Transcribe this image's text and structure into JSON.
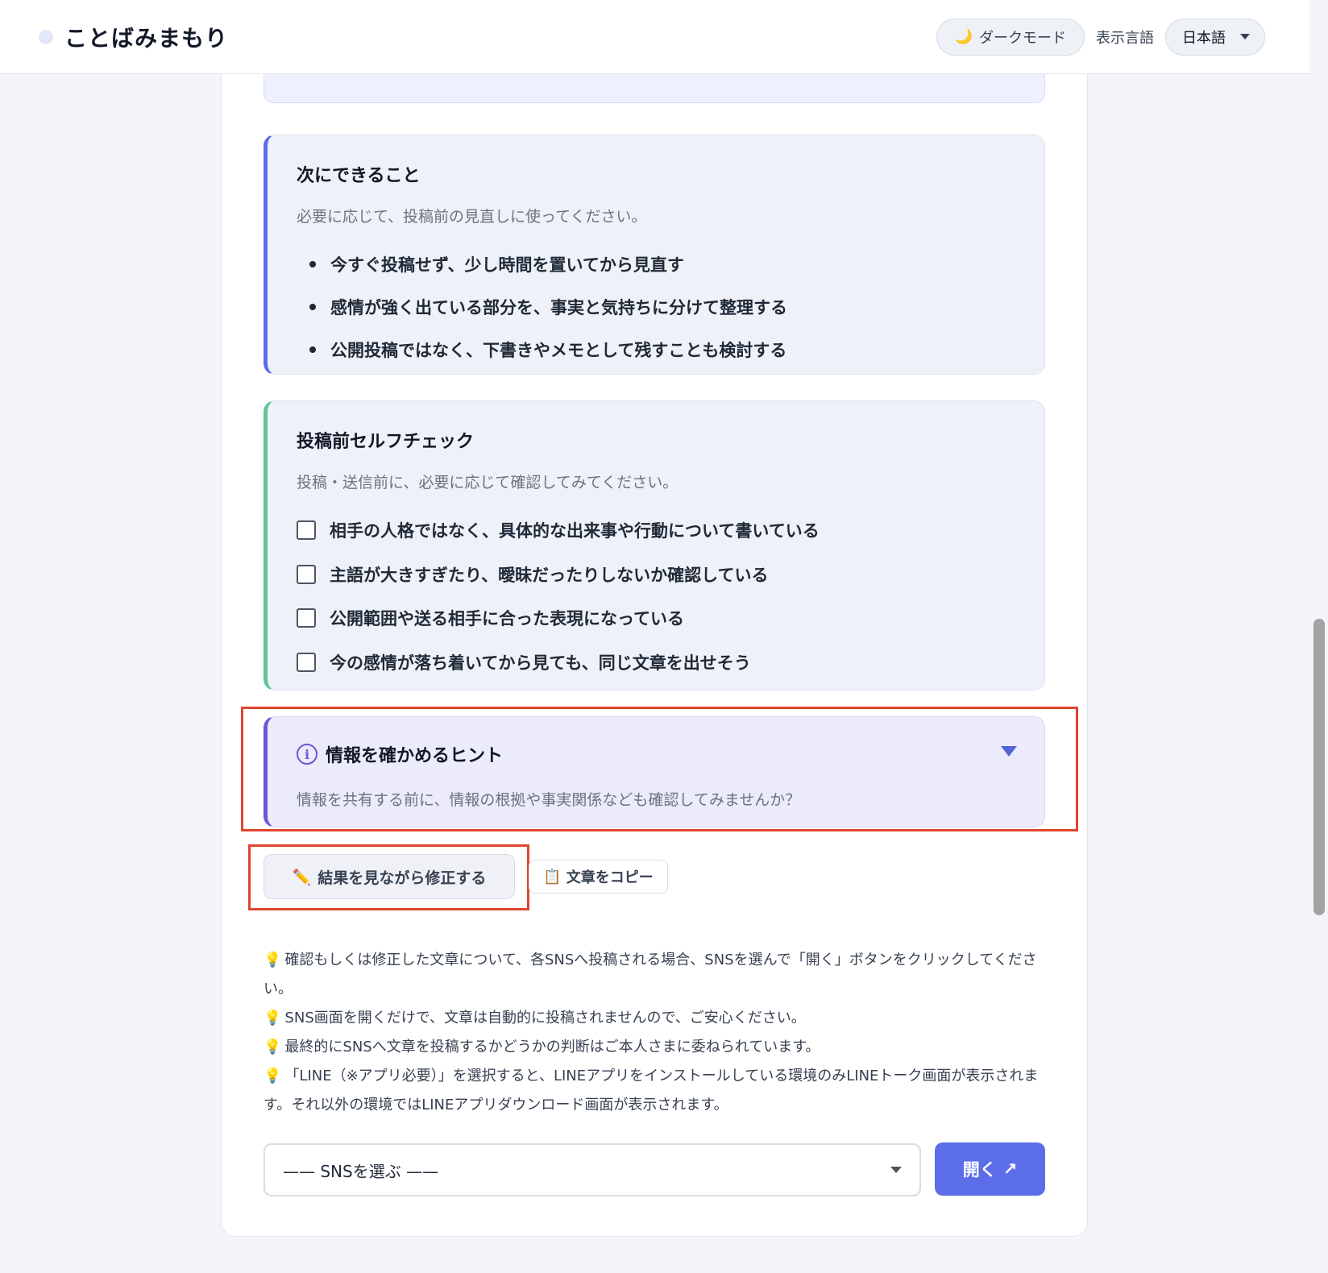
{
  "header": {
    "title": "ことばみまもり",
    "dark_mode_label": "ダークモード",
    "dark_mode_icon": "moon-icon",
    "language_label": "表示言語",
    "language_value": "日本語"
  },
  "next_steps": {
    "title": "次にできること",
    "subtitle": "必要に応じて、投稿前の見直しに使ってください。",
    "items": [
      "今すぐ投稿せず、少し時間を置いてから見直す",
      "感情が強く出ている部分を、事実と気持ちに分けて整理する",
      "公開投稿ではなく、下書きやメモとして残すことも検討する"
    ]
  },
  "self_check": {
    "title": "投稿前セルフチェック",
    "subtitle": "投稿・送信前に、必要に応じて確認してみてください。",
    "items": [
      "相手の人格ではなく、具体的な出来事や行動について書いている",
      "主語が大きすぎたり、曖昧だったりしないか確認している",
      "公開範囲や送る相手に合った表現になっている",
      "今の感情が落ち着いてから見ても、同じ文章を出せそう"
    ]
  },
  "hint": {
    "title": "情報を確かめるヒント",
    "text": "情報を共有する前に、情報の根拠や事実関係なども確認してみませんか？"
  },
  "actions": {
    "edit_label": "結果を見ながら修正する",
    "copy_label": "文章をコピー"
  },
  "notes": [
    "確認もしくは修正した文章について、各SNSへ投稿される場合、SNSを選んで「開く」ボタンをクリックしてください。",
    "SNS画面を開くだけで、文章は自動的に投稿されませんので、ご安心ください。",
    "最終的にSNSへ文章を投稿するかどうかの判断はご本人さまに委ねられています。",
    "「LINE（※アプリ必要）」を選択すると、LINEアプリをインストールしている環境のみLINEトーク画面が表示されます。それ以外の環境ではLINEアプリダウンロード画面が表示されます。"
  ],
  "sns": {
    "placeholder": "—— SNSを選ぶ ——",
    "open_label": "開く"
  },
  "colors": {
    "accent": "#5b6ee8",
    "green_accent": "#5fc59a",
    "purple_accent": "#6b57d6",
    "highlight": "#e0452f"
  }
}
